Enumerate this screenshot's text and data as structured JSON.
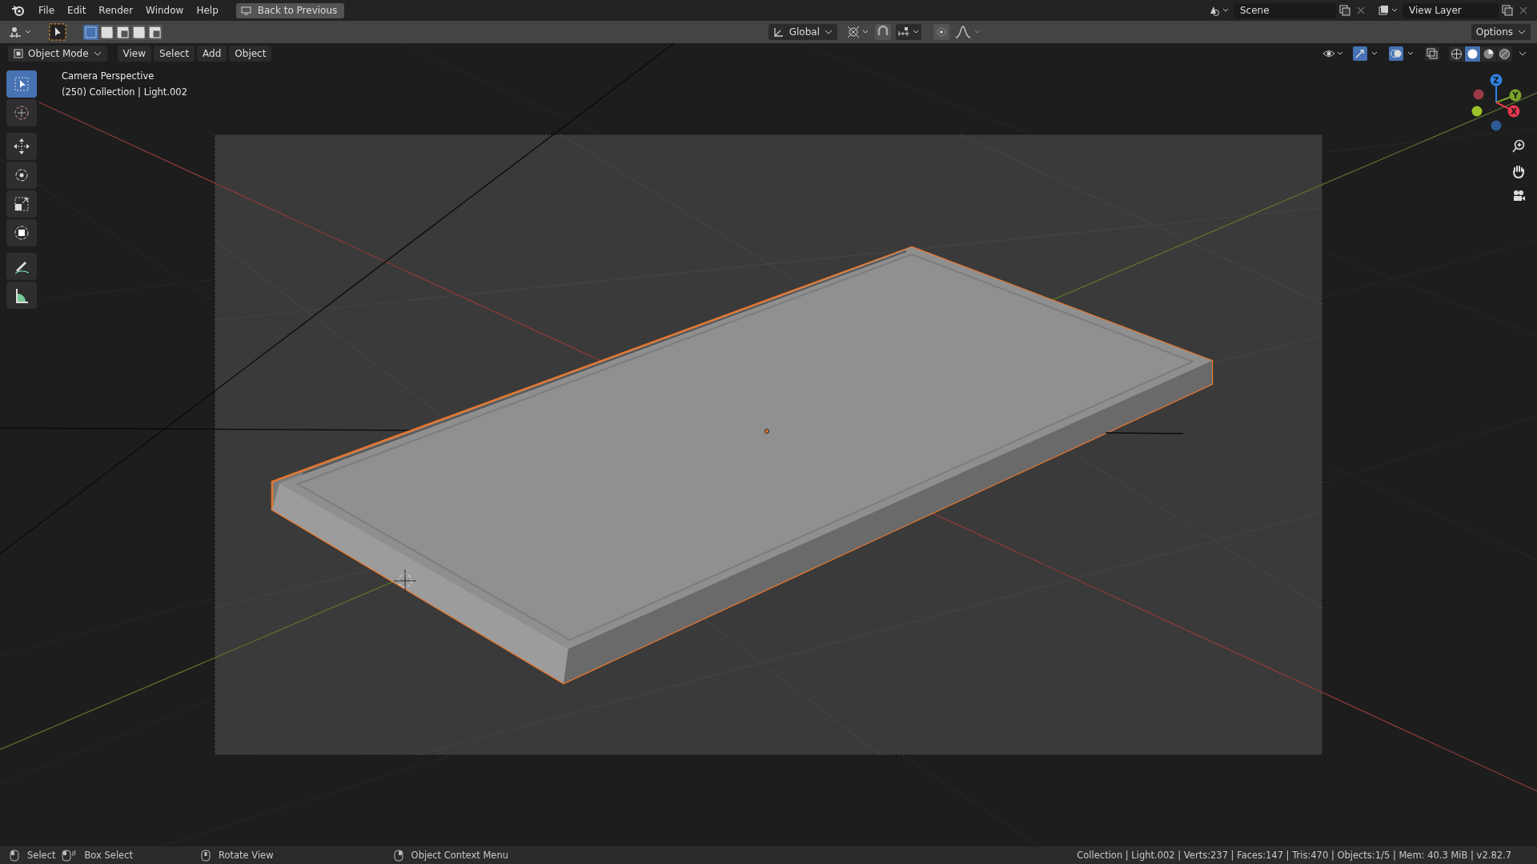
{
  "menubar": {
    "items": [
      "File",
      "Edit",
      "Render",
      "Window",
      "Help"
    ],
    "back_button": "Back to Previous"
  },
  "workspace": {
    "scene": "Scene",
    "view_layer": "View Layer"
  },
  "tool_header": {
    "select_modes": [
      {
        "selected": true
      },
      {
        "selected": false
      },
      {
        "selected": false
      },
      {
        "selected": false
      },
      {
        "selected": false
      }
    ],
    "orientation": "Global",
    "options": "Options"
  },
  "viewport_header": {
    "mode": "Object Mode",
    "menus": [
      "View",
      "Select",
      "Add",
      "Object"
    ],
    "shading": [
      {
        "kind": "wireframe",
        "selected": false
      },
      {
        "kind": "solid",
        "selected": true
      },
      {
        "kind": "material",
        "selected": false
      },
      {
        "kind": "rendered",
        "selected": false
      }
    ]
  },
  "toolbar": {
    "tools": [
      {
        "kind": "select",
        "selected": true
      },
      {
        "kind": "cursor",
        "selected": false
      },
      {
        "kind": "move",
        "selected": false
      },
      {
        "kind": "rotate",
        "selected": false
      },
      {
        "kind": "scale",
        "selected": false
      },
      {
        "kind": "transform",
        "selected": false
      },
      {
        "kind": "annotate",
        "selected": false
      },
      {
        "kind": "measure",
        "selected": false
      }
    ]
  },
  "viewport": {
    "view_name": "Camera Perspective",
    "object_info": "(250) Collection | Light.002"
  },
  "gizmo": {
    "axes": [
      {
        "label": "Z",
        "color": "#2f83e6"
      },
      {
        "label": "Y",
        "color": "#7aa32a"
      },
      {
        "label": "X",
        "color": "#e8384f"
      }
    ]
  },
  "status_bar": {
    "hints": [
      {
        "kind": "left",
        "label": "Select"
      },
      {
        "kind": "drag",
        "label": "Box Select"
      },
      {
        "kind": "middle",
        "label": "Rotate View"
      },
      {
        "kind": "right",
        "label": "Object Context Menu"
      }
    ],
    "stats": "Collection | Light.002 | Verts:237 | Faces:147 | Tris:470 | Objects:1/5 | Mem: 40.3 MiB | v2.82.7"
  }
}
